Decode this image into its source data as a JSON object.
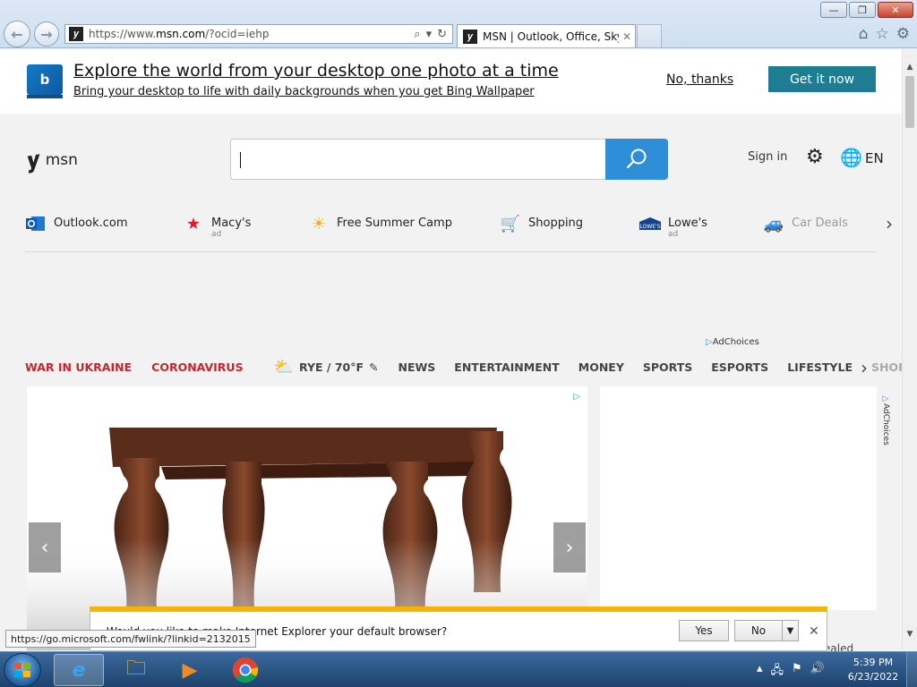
{
  "browser": {
    "address_prefix": "https://www.",
    "address_domain": "msn.com",
    "address_suffix": "/?ocid=iehp",
    "tab_title": "MSN | Outlook, Office, Sky...",
    "status_url": "https://go.microsoft.com/fwlink/?linkid=2132015"
  },
  "promo": {
    "title": "Explore the world from your desktop one photo at a time",
    "subtitle": "Bring your desktop to life with daily backgrounds when you get Bing Wallpaper",
    "no_thanks": "No, thanks",
    "get_it": "Get it now"
  },
  "header": {
    "logo_text": "msn",
    "search_value": "",
    "sign_in": "Sign in",
    "language": "EN"
  },
  "quicklinks": [
    {
      "label": "Outlook.com",
      "ad": ""
    },
    {
      "label": "Macy's",
      "ad": "ad"
    },
    {
      "label": "Free Summer Camp",
      "ad": ""
    },
    {
      "label": "Shopping",
      "ad": ""
    },
    {
      "label": "Lowe's",
      "ad": "ad"
    },
    {
      "label": "Car Deals",
      "ad": ""
    }
  ],
  "adchoices": "AdChoices",
  "nav": {
    "war": "WAR IN UKRAINE",
    "corona": "CORONAVIRUS",
    "weather": "RYE / 70°F",
    "items": [
      "NEWS",
      "ENTERTAINMENT",
      "MONEY",
      "SPORTS",
      "ESPORTS",
      "LIFESTYLE",
      "SHOPPING"
    ]
  },
  "side_text": "ealed",
  "notification": {
    "text": "Would you like to make Internet Explorer your default browser?",
    "yes": "Yes",
    "no": "No"
  },
  "taskbar": {
    "time": "5:39 PM",
    "date": "6/23/2022"
  },
  "colors": {
    "accent": "#2f8ed8",
    "get_it_bg": "#1e7d93",
    "war_red": "#c1272d",
    "notif_bar": "#f5b400"
  }
}
